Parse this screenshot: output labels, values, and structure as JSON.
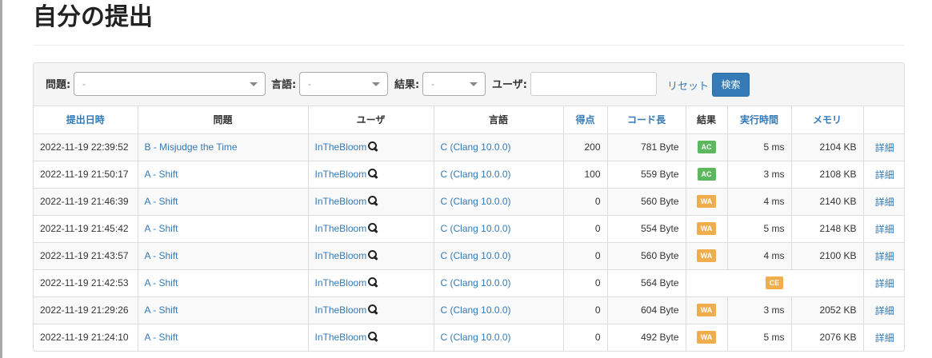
{
  "page": {
    "title": "自分の提出"
  },
  "filters": {
    "problem_label": "問題:",
    "problem_value": "-",
    "language_label": "言語:",
    "language_value": "-",
    "result_label": "結果:",
    "result_value": "-",
    "user_label": "ユーザ:",
    "user_value": "",
    "reset_label": "リセット",
    "search_label": "検索"
  },
  "table": {
    "headers": {
      "submit_time": "提出日時",
      "problem": "問題",
      "user": "ユーザ",
      "language": "言語",
      "score": "得点",
      "code_length": "コード長",
      "result": "結果",
      "exec_time": "実行時間",
      "memory": "メモリ",
      "detail": ""
    },
    "rows": [
      {
        "time": "2022-11-19 22:39:52",
        "problem": "B - Misjudge the Time",
        "user": "InTheBloom",
        "language": "C (Clang 10.0.0)",
        "score": "200",
        "length": "781 Byte",
        "result": "AC",
        "exec": "5 ms",
        "memory": "2104 KB",
        "detail": "詳細"
      },
      {
        "time": "2022-11-19 21:50:17",
        "problem": "A - Shift",
        "user": "InTheBloom",
        "language": "C (Clang 10.0.0)",
        "score": "100",
        "length": "559 Byte",
        "result": "AC",
        "exec": "3 ms",
        "memory": "2108 KB",
        "detail": "詳細"
      },
      {
        "time": "2022-11-19 21:46:39",
        "problem": "A - Shift",
        "user": "InTheBloom",
        "language": "C (Clang 10.0.0)",
        "score": "0",
        "length": "560 Byte",
        "result": "WA",
        "exec": "4 ms",
        "memory": "2140 KB",
        "detail": "詳細"
      },
      {
        "time": "2022-11-19 21:45:42",
        "problem": "A - Shift",
        "user": "InTheBloom",
        "language": "C (Clang 10.0.0)",
        "score": "0",
        "length": "554 Byte",
        "result": "WA",
        "exec": "5 ms",
        "memory": "2148 KB",
        "detail": "詳細"
      },
      {
        "time": "2022-11-19 21:43:57",
        "problem": "A - Shift",
        "user": "InTheBloom",
        "language": "C (Clang 10.0.0)",
        "score": "0",
        "length": "560 Byte",
        "result": "WA",
        "exec": "4 ms",
        "memory": "2100 KB",
        "detail": "詳細"
      },
      {
        "time": "2022-11-19 21:42:53",
        "problem": "A - Shift",
        "user": "InTheBloom",
        "language": "C (Clang 10.0.0)",
        "score": "0",
        "length": "564 Byte",
        "result": "CE",
        "exec": "",
        "memory": "",
        "detail": "詳細"
      },
      {
        "time": "2022-11-19 21:29:26",
        "problem": "A - Shift",
        "user": "InTheBloom",
        "language": "C (Clang 10.0.0)",
        "score": "0",
        "length": "604 Byte",
        "result": "WA",
        "exec": "3 ms",
        "memory": "2052 KB",
        "detail": "詳細"
      },
      {
        "time": "2022-11-19 21:24:10",
        "problem": "A - Shift",
        "user": "InTheBloom",
        "language": "C (Clang 10.0.0)",
        "score": "0",
        "length": "492 Byte",
        "result": "WA",
        "exec": "5 ms",
        "memory": "2076 KB",
        "detail": "詳細"
      }
    ]
  },
  "colors": {
    "link": "#337ab7",
    "ac": "#5cb85c",
    "wa": "#f0ad4e",
    "ce": "#f0ad4e"
  },
  "icons": {
    "user_search": "search-icon"
  }
}
